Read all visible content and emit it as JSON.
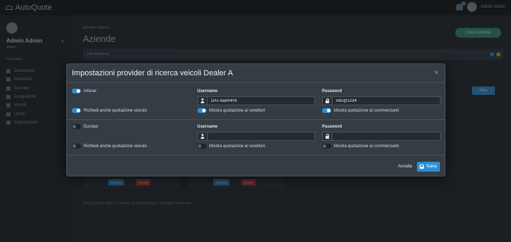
{
  "app": {
    "name": "AutoQuote",
    "top_user": "Admin Admin"
  },
  "sidebar": {
    "user_name": "Admin Admin",
    "user_role": "admin",
    "section": "Navigation",
    "items": [
      {
        "label": "Dashboard"
      },
      {
        "label": "Preventivi"
      },
      {
        "label": "Aziende"
      },
      {
        "label": "Anagrafiche"
      },
      {
        "label": "Veicoli"
      },
      {
        "label": "Utenti"
      },
      {
        "label": "Impostazioni"
      }
    ]
  },
  "page": {
    "breadcrumb": "Aziende / Elenco",
    "title": "Aziende",
    "new_button": "Crea Azienda",
    "filter_title": "Filtri di ricerca",
    "filter_button": "Filtra",
    "edit_label": "Modifica",
    "delete_label": "Elimina",
    "footer": "Auto Quote © 2016 © Software di Trattive Brand - All Rights Reserved"
  },
  "modal": {
    "title": "Impostazioni provider di ricerca veicoli Dealer A",
    "providers": [
      {
        "name": "Infocar",
        "enabled": true,
        "username_label": "Username",
        "username": "DAT-damHHX",
        "password_label": "Password",
        "password": "Abc@1234",
        "quote_label": "Richiedi anche quotazione veicolo",
        "quote": true,
        "sellers_label": "Mostra quotazione ai venditori",
        "sellers": true,
        "dealers_label": "Mostra quotazione ai commercianti",
        "dealers": true
      },
      {
        "name": "Eurotax",
        "enabled": false,
        "username_label": "Username",
        "username": "",
        "password_label": "Password",
        "password": "",
        "quote_label": "Richiedi anche quotazione veicolo",
        "quote": false,
        "sellers_label": "Mostra quotazione ai venditori",
        "sellers": false,
        "dealers_label": "Mostra quotazione ai commercianti",
        "dealers": false
      }
    ],
    "cancel_label": "Annulla",
    "save_label": "Salva"
  },
  "colors": {
    "accent": "#2b8fd8",
    "modal_bg": "#353c43",
    "success": "#2f8f7a"
  },
  "icons": [
    "logo-icon",
    "bell-icon",
    "user-icon",
    "lock-icon",
    "close-icon",
    "save-icon"
  ]
}
